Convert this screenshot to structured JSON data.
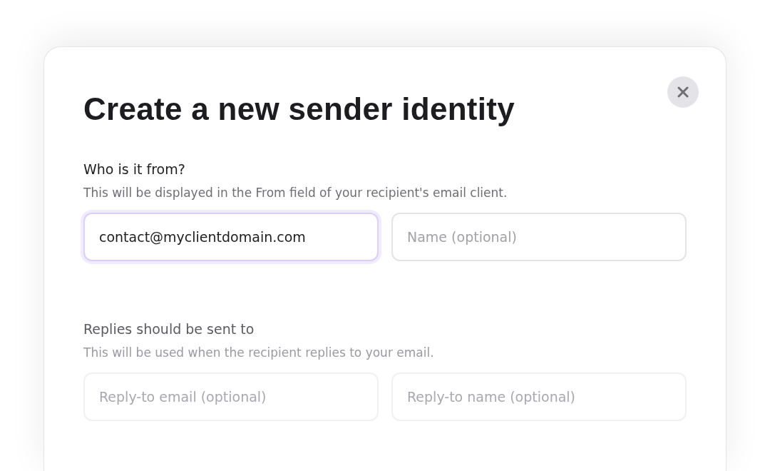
{
  "dialog": {
    "title": "Create a new sender identity",
    "sections": [
      {
        "label": "Who is it from?",
        "description": "This will be displayed in the From field of your recipient's email client.",
        "dimmed": false,
        "fields": [
          {
            "value": "contact@myclientdomain.com",
            "focused": true
          },
          {
            "placeholder": "Name (optional)",
            "focused": false
          }
        ]
      },
      {
        "label": "Replies should be sent to",
        "description": "This will be used when the recipient replies to your email.",
        "dimmed": true,
        "fields": [
          {
            "placeholder": "Reply-to email (optional)",
            "focused": false
          },
          {
            "placeholder": "Reply-to name (optional)",
            "focused": false
          }
        ]
      }
    ]
  }
}
